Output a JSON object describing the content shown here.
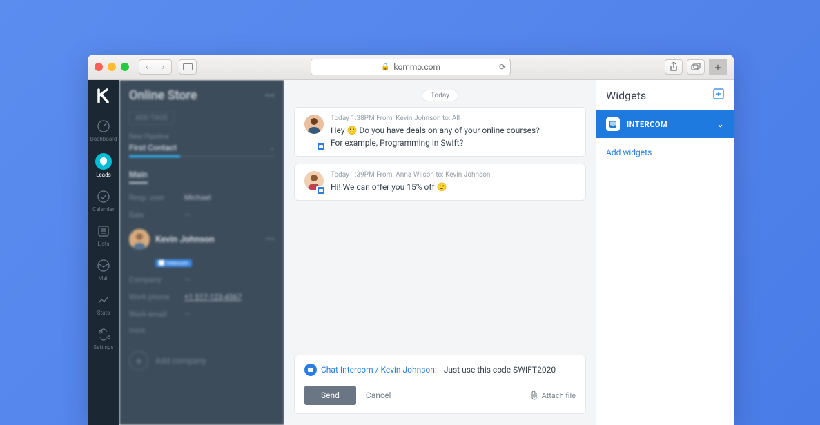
{
  "browser": {
    "url": "kommo.com"
  },
  "nav": {
    "items": [
      {
        "key": "dashboard",
        "label": "Dashboard"
      },
      {
        "key": "leads",
        "label": "Leads"
      },
      {
        "key": "calendar",
        "label": "Calendar"
      },
      {
        "key": "lists",
        "label": "Lists"
      },
      {
        "key": "mail",
        "label": "Mail"
      },
      {
        "key": "stats",
        "label": "Stats"
      },
      {
        "key": "settings",
        "label": "Settings"
      }
    ]
  },
  "lead": {
    "title": "Online Store",
    "add_tags": "ADD TAGS",
    "pipeline_label": "New Pipeline",
    "pipeline_value": "First Contact",
    "main_tab": "Main",
    "fields": {
      "resp_user_label": "Resp. user",
      "resp_user_value": "Michael",
      "sale_label": "Sale",
      "sale_value": "—",
      "company_label": "Company",
      "company_value": "—",
      "work_phone_label": "Work phone",
      "work_phone_value": "+1 517-123-4567",
      "work_email_label": "Work email",
      "work_email_value": "—"
    },
    "contact_name": "Kevin Johnson",
    "intercom_badge": "Intercom",
    "more": "more",
    "add_company": "Add company"
  },
  "chat": {
    "date": "Today",
    "messages": [
      {
        "meta": "Today 1:38PM From: Kevin Johnson to: All",
        "line1": "Hey 🙂  Do you have deals on any of your online courses?",
        "line2": "For example, Programming in Swift?"
      },
      {
        "meta": "Today 1:39PM From: Anna Wilson to: Kevin Johnson",
        "line1": "Hi! We can offer you 15% off  🙂",
        "line2": ""
      }
    ],
    "compose": {
      "label": "Chat Intercom / Kevin Johnson:",
      "text": "Just use this code SWIFT2020",
      "send": "Send",
      "cancel": "Cancel",
      "attach": "Attach file"
    }
  },
  "widgets": {
    "title": "Widgets",
    "item_label": "INTERCOM",
    "add_link": "Add widgets"
  }
}
